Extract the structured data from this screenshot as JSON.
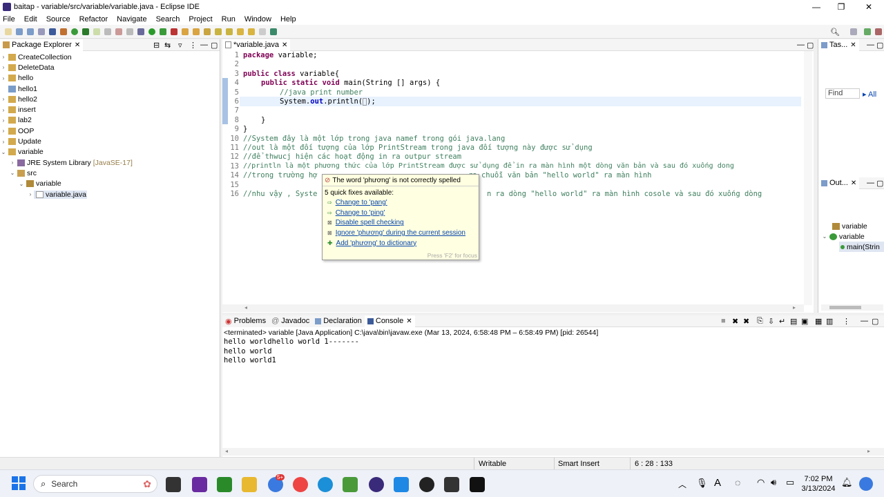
{
  "window": {
    "title": "baitap - variable/src/variable/variable.java - Eclipse IDE"
  },
  "menu": [
    "File",
    "Edit",
    "Source",
    "Refactor",
    "Navigate",
    "Search",
    "Project",
    "Run",
    "Window",
    "Help"
  ],
  "package_explorer": {
    "title": "Package Explorer",
    "items": [
      {
        "label": "CreateCollection"
      },
      {
        "label": "DeleteData"
      },
      {
        "label": "hello"
      },
      {
        "label": "hello1"
      },
      {
        "label": "hello2"
      },
      {
        "label": "insert"
      },
      {
        "label": "lab2"
      },
      {
        "label": "OOP"
      },
      {
        "label": "Update"
      },
      {
        "label": "variable"
      },
      {
        "label": "JRE System Library",
        "suffix": "[JavaSE-17]"
      },
      {
        "label": "src"
      },
      {
        "label": "variable"
      },
      {
        "label": "variable.java"
      }
    ]
  },
  "editor": {
    "tab": "*variable.java",
    "line_numbers": [
      "1",
      "2",
      "3",
      "4",
      "5",
      "6",
      "7",
      "8",
      "9",
      "10",
      "11",
      "12",
      "13",
      "14",
      "15",
      "16"
    ],
    "lines": {
      "l1_kw": "package",
      "l1_rest": " variable;",
      "l3_kw": "public class",
      "l3_rest": " variable{",
      "l4_kw": "public static void",
      "l4_rest": " main(String [] args) {",
      "l5": "//java print number",
      "l6_a": "System.",
      "l6_fld": "out",
      "l6_b": ".println(",
      "l6_c": ");",
      "l8": "}",
      "l9": "}",
      "l10": "//System đây là một lớp trong java namef trong gói java.lang",
      "l11": "//out là một đối tượng của lớp PrintStream trong java đối tượng này được sử dụng",
      "l12": "//để thwucj hiện các hoạt động in ra outpur stream",
      "l13": "//println là một phương thức của lớp PrintStream được sử dụng để in ra màn hình một dòng văn bản và sau đó xuống dong",
      "l14a": "//trong trường hợ",
      "l14b": "ra chuỗi văn bản \"hello world\" ra màn hình",
      "l16a": "//nhu vậy , Syste",
      "l16b": "n ra dòng \"hello world\" ra màn hình cosole và sau đó xuống dòng"
    }
  },
  "popup": {
    "header": "The word 'phương' is not correctly spelled",
    "subheader": "5 quick fixes available:",
    "fixes": [
      "Change to 'pang'",
      "Change to 'ping'",
      "Disable spell checking",
      "Ignore 'phương' during the current session",
      "Add 'phương' to dictionary"
    ],
    "footer": "Press 'F2' for focus"
  },
  "right_views": {
    "tasks_title": "Tas...",
    "find_placeholder": "Find",
    "all_label": "All",
    "outline_title": "Out...",
    "outline_items": [
      "variable",
      "variable",
      "main(Strin"
    ]
  },
  "console": {
    "tabs": [
      "Problems",
      "Javadoc",
      "Declaration",
      "Console"
    ],
    "status": "<terminated> variable [Java Application] C:\\java\\bin\\javaw.exe  (Mar 13, 2024, 6:58:48 PM – 6:58:49 PM) [pid: 26544]",
    "output": [
      "hello worldhello world 1-------",
      "hello world",
      "hello world1"
    ]
  },
  "statusbar": {
    "writable": "Writable",
    "insert": "Smart Insert",
    "position": "6 : 28 : 133"
  },
  "taskbar": {
    "search": "Search",
    "time": "7:02 PM",
    "date": "3/13/2024",
    "badge": "5+"
  },
  "colors": {
    "keyword": "#7f0055",
    "comment": "#3f7f5f",
    "string": "#2a00ff",
    "field": "#0000c0",
    "link": "#0645ad",
    "popup_bg": "#ffffe1"
  }
}
